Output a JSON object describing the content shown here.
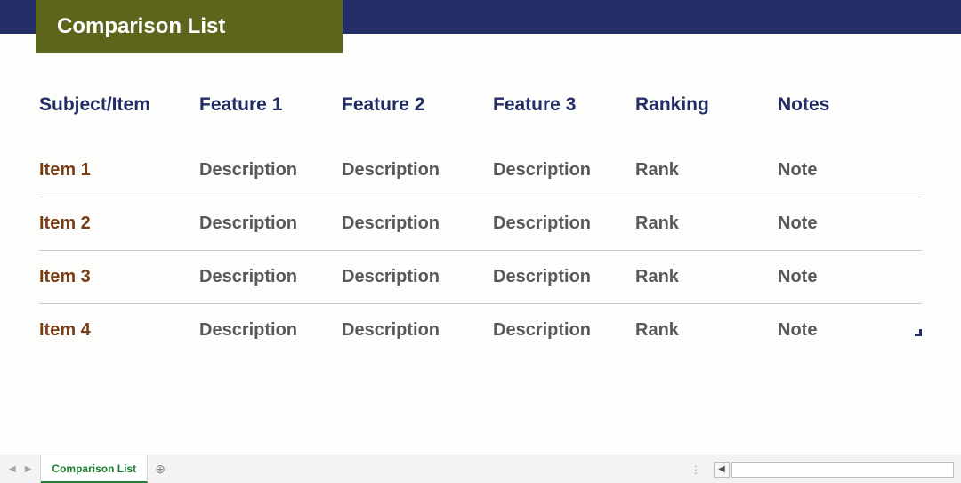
{
  "title": "Comparison List",
  "headers": {
    "subject": "Subject/Item",
    "f1": "Feature 1",
    "f2": "Feature 2",
    "f3": "Feature 3",
    "rank": "Ranking",
    "notes": "Notes"
  },
  "rows": [
    {
      "subject": "Item 1",
      "f1": "Description",
      "f2": "Description",
      "f3": "Description",
      "rank": "Rank",
      "notes": "Note"
    },
    {
      "subject": "Item 2",
      "f1": "Description",
      "f2": "Description",
      "f3": "Description",
      "rank": "Rank",
      "notes": "Note"
    },
    {
      "subject": "Item 3",
      "f1": "Description",
      "f2": "Description",
      "f3": "Description",
      "rank": "Rank",
      "notes": "Note"
    },
    {
      "subject": "Item 4",
      "f1": "Description",
      "f2": "Description",
      "f3": "Description",
      "rank": "Rank",
      "notes": "Note"
    }
  ],
  "sheet_tab": "Comparison List"
}
